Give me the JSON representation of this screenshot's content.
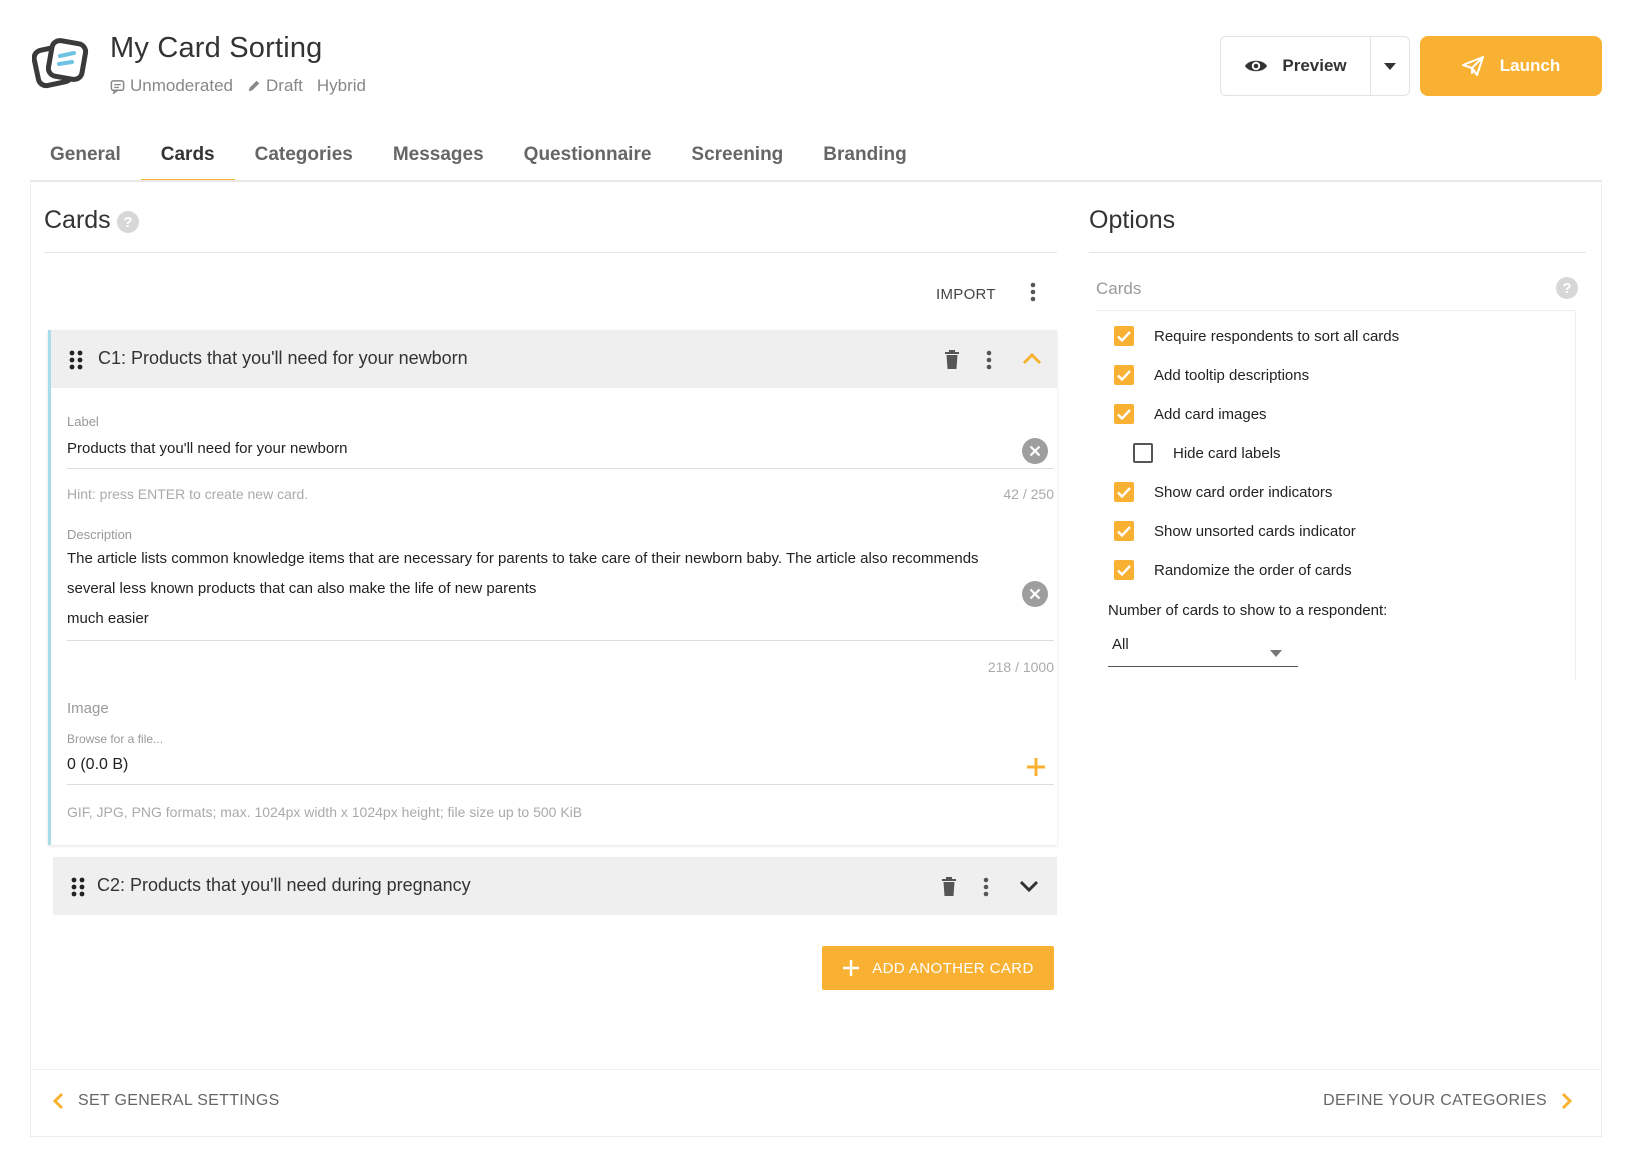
{
  "header": {
    "title": "My Card Sorting",
    "meta": {
      "mode": "Unmoderated",
      "status": "Draft",
      "type": "Hybrid"
    },
    "preview_label": "Preview",
    "launch_label": "Launch"
  },
  "tabs": [
    {
      "label": "General"
    },
    {
      "label": "Cards",
      "active": true
    },
    {
      "label": "Categories"
    },
    {
      "label": "Messages"
    },
    {
      "label": "Questionnaire"
    },
    {
      "label": "Screening"
    },
    {
      "label": "Branding"
    }
  ],
  "cards_section": {
    "title": "Cards",
    "help": "?",
    "import_label": "IMPORT",
    "cards": [
      {
        "title": "C1: Products that you'll need for your newborn",
        "expanded": true,
        "label_field": {
          "label": "Label",
          "value": "Products that you'll need for your newborn",
          "hint": "Hint: press ENTER to create new card.",
          "counter": "42 / 250"
        },
        "description_field": {
          "label": "Description",
          "lines": [
            "The article lists common knowledge items that are necessary for parents to take care of their newborn baby. The article also recommends",
            "several less known products that can also make the life of new parents",
            "much easier"
          ],
          "counter": "218 / 1000"
        },
        "image_field": {
          "label": "Image",
          "browse_label": "Browse for a file...",
          "value": "0 (0.0 B)",
          "hint": "GIF, JPG, PNG formats; max. 1024px width x 1024px height; file size up to 500 KiB"
        }
      },
      {
        "title": "C2: Products that you'll need during pregnancy",
        "expanded": false
      }
    ],
    "add_button_label": "ADD ANOTHER CARD"
  },
  "options": {
    "title": "Options",
    "subsection": "Cards",
    "help": "?",
    "checkboxes": [
      {
        "label": "Require respondents to sort all cards",
        "checked": true
      },
      {
        "label": "Add tooltip descriptions",
        "checked": true
      },
      {
        "label": "Add card images",
        "checked": true
      },
      {
        "label": "Hide card labels",
        "checked": false
      },
      {
        "label": "Show card order indicators",
        "checked": true
      },
      {
        "label": "Show unsorted cards indicator",
        "checked": true
      },
      {
        "label": "Randomize the order of cards",
        "checked": true
      }
    ],
    "num_cards_label": "Number of cards to show to a respondent:",
    "num_cards_value": "All"
  },
  "footer": {
    "prev_label": "SET GENERAL SETTINGS",
    "next_label": "DEFINE YOUR CATEGORIES"
  },
  "colors": {
    "accent": "#f8b133",
    "card_border": "#a9dbe8",
    "header_bg": "#efefef"
  }
}
